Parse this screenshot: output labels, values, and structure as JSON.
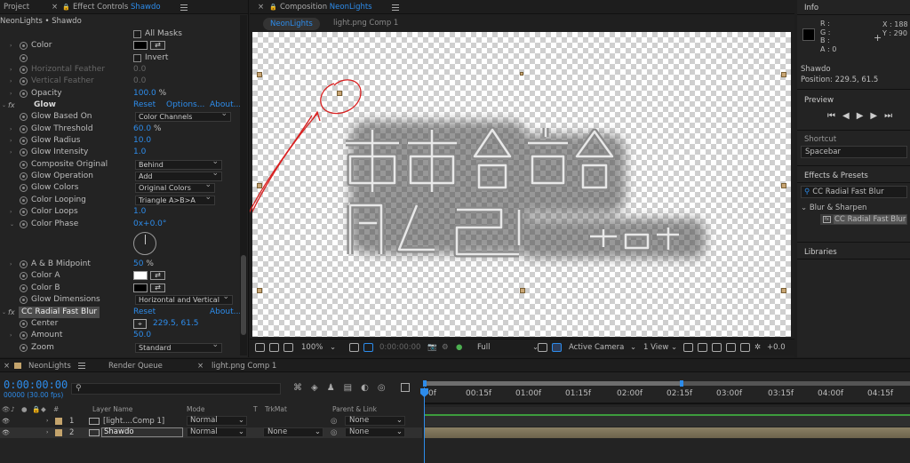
{
  "effect_controls": {
    "tabs": {
      "project": "Project",
      "effect_controls": "Effect Controls",
      "effect_controls_layer": "Shawdo"
    },
    "breadcrumb": "NeonLights • Shawdo",
    "rows": {
      "all_masks": "All Masks",
      "color": "Color",
      "invert": "Invert",
      "horizontal_feather": "Horizontal Feather",
      "horizontal_feather_val": "0.0",
      "vertical_feather": "Vertical Feather",
      "vertical_feather_val": "0.0",
      "opacity": "Opacity",
      "opacity_val": "100.0",
      "percent": "%"
    },
    "glow": {
      "fx": "fx",
      "name": "Glow",
      "reset": "Reset",
      "options": "Options...",
      "about": "About...",
      "based_on": "Glow Based On",
      "based_on_val": "Color Channels",
      "threshold": "Glow Threshold",
      "threshold_val": "60.0",
      "radius": "Glow Radius",
      "radius_val": "10.0",
      "intensity": "Glow Intensity",
      "intensity_val": "1.0",
      "composite": "Composite Original",
      "composite_val": "Behind",
      "operation": "Glow Operation",
      "operation_val": "Add",
      "colors": "Glow Colors",
      "colors_val": "Original Colors",
      "looping": "Color Looping",
      "looping_val": "Triangle A>B>A",
      "loops": "Color Loops",
      "loops_val": "1.0",
      "phase": "Color Phase",
      "phase_val": "0x+0.0°",
      "midpoint": "A & B Midpoint",
      "midpoint_val": "50",
      "color_a": "Color A",
      "color_b": "Color B",
      "dimensions": "Glow Dimensions",
      "dimensions_val": "Horizontal and Vertical"
    },
    "radial_blur": {
      "fx": "fx",
      "name": "CC Radial Fast Blur",
      "reset": "Reset",
      "about": "About...",
      "center": "Center",
      "center_val": "229.5, 61.5",
      "amount": "Amount",
      "amount_val": "50.0",
      "zoom": "Zoom",
      "zoom_val": "Standard"
    }
  },
  "composition": {
    "tab_prefix": "Composition",
    "tab_name": "NeonLights",
    "sub_tab_active": "NeonLights",
    "sub_tab_other": "light.png Comp 1",
    "zoom": "100%",
    "timecode": "0:00:00:00",
    "resolution": "Full",
    "camera": "Active Camera",
    "view": "1 View",
    "exposure": "+0.0"
  },
  "info_panel": {
    "title": "Info",
    "r": "R :",
    "g": "G :",
    "b": "B :",
    "a": "A :",
    "a_val": "0",
    "x": "X : 188",
    "y": "Y : 290",
    "layer": "Shawdo",
    "position": "Position: 229.5, 61.5"
  },
  "preview_panel": {
    "title": "Preview"
  },
  "shortcut_panel": {
    "title": "Shortcut",
    "value": "Spacebar"
  },
  "effects_presets": {
    "title": "Effects & Presets",
    "search": "CC Radial Fast Blur",
    "category": "Blur & Sharpen",
    "item": "CC Radial Fast Blur"
  },
  "libraries": {
    "title": "Libraries"
  },
  "timeline": {
    "tabs": {
      "active": "NeonLights",
      "render_queue": "Render Queue",
      "other": "light.png Comp 1"
    },
    "timecode": "0:00:00:00",
    "fps": "00000 (30.00 fps)",
    "headers": {
      "layer_name": "Layer Name",
      "mode": "Mode",
      "t": "T",
      "trkmat": "TrkMat",
      "parent": "Parent & Link"
    },
    "ruler": [
      "0f",
      "00:15f",
      "01:00f",
      "01:15f",
      "02:00f",
      "02:15f",
      "03:00f",
      "03:15f",
      "04:00f",
      "04:15f"
    ],
    "layers": [
      {
        "num": "1",
        "name": "[light....Comp 1]",
        "mode": "Normal",
        "trkmat": "",
        "parent": "None"
      },
      {
        "num": "2",
        "name": "Shawdo",
        "mode": "Normal",
        "trkmat": "None",
        "parent": "None"
      }
    ]
  },
  "colors": {
    "accent": "#2d8ceb",
    "panel": "#232323",
    "layer_tan": "#c4a46c",
    "annotation": "#d92020",
    "track_green": "#3d9c3d"
  }
}
